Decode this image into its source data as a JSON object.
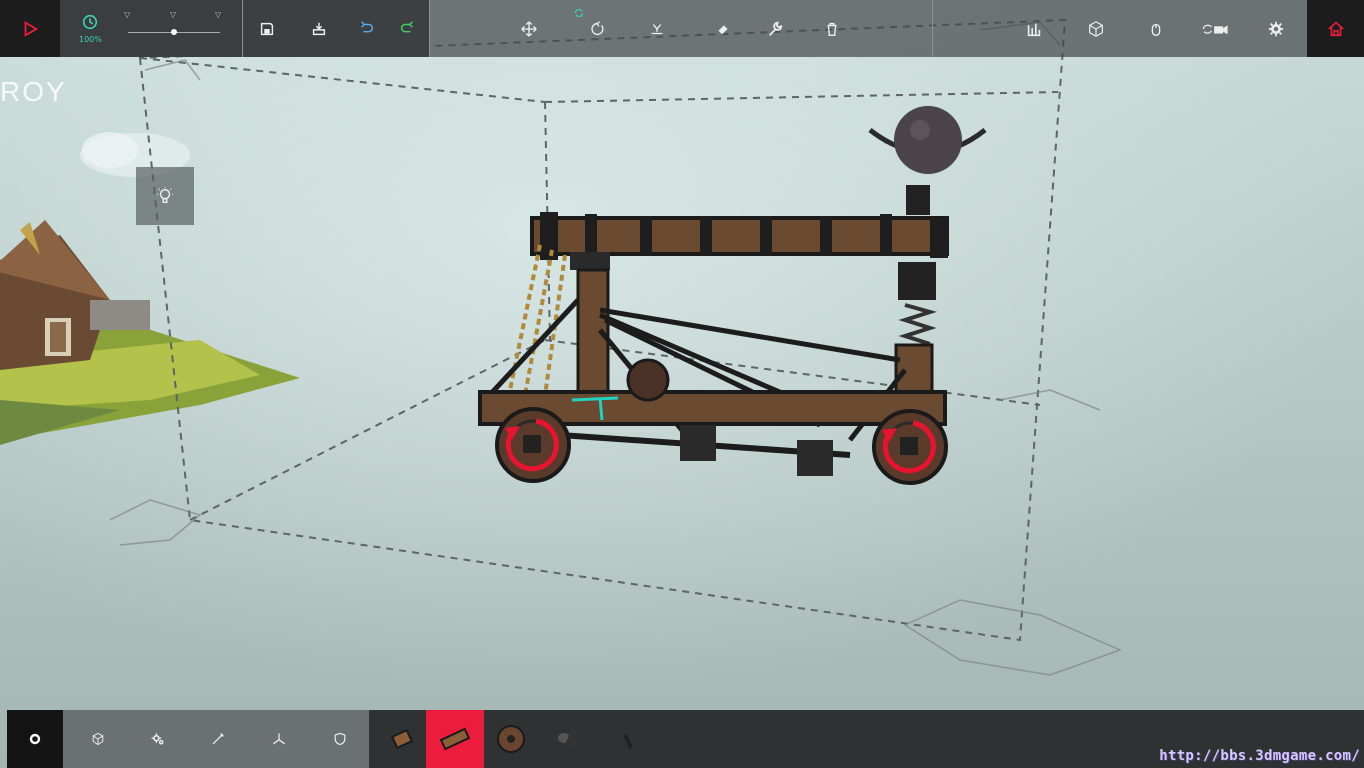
{
  "toolbar": {
    "speed_label": "100%",
    "play_icon": "play-icon",
    "home_icon": "home-icon"
  },
  "background_text": "ROY",
  "watermark": "http://bbs.3dmgame.com/",
  "categories": [
    {
      "icon": "gear-ring-icon",
      "active": true
    },
    {
      "icon": "cube-icon",
      "active": false
    },
    {
      "icon": "gears-icon",
      "active": false
    },
    {
      "icon": "wand-icon",
      "active": false
    },
    {
      "icon": "tripod-icon",
      "active": false
    },
    {
      "icon": "shield-icon",
      "active": false
    }
  ],
  "parts": [
    {
      "icon": "small-block-icon",
      "active": false
    },
    {
      "icon": "wooden-block-icon",
      "active": true
    },
    {
      "icon": "wheel-icon",
      "active": false
    },
    {
      "icon": "large-wheel-icon",
      "active": false
    },
    {
      "icon": "hinge-icon",
      "active": false
    }
  ],
  "colors": {
    "accent_red": "#ec1c3c",
    "accent_teal": "#3fd0b5",
    "bar_dark": "#1d1d1d"
  }
}
